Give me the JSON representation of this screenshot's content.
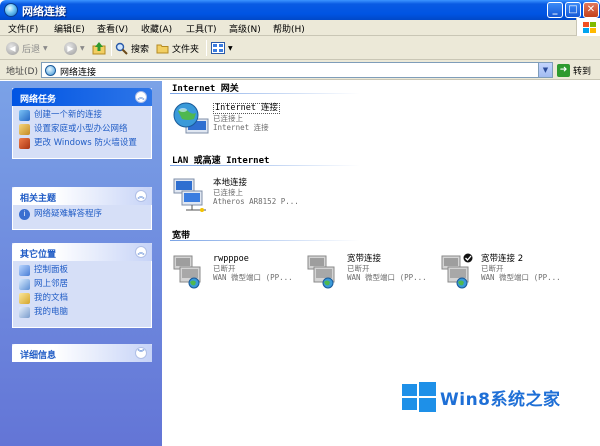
{
  "window": {
    "title": "网络连接"
  },
  "menu": [
    "文件(F)",
    "编辑(E)",
    "查看(V)",
    "收藏(A)",
    "工具(T)",
    "高级(N)",
    "帮助(H)"
  ],
  "toolbar": {
    "back": "后退",
    "search": "搜索",
    "folders": "文件夹"
  },
  "address": {
    "label": "地址(D)",
    "value": "网络连接",
    "go": "转到"
  },
  "taskpane": {
    "network_tasks": {
      "title": "网络任务",
      "items": [
        "创建一个新的连接",
        "设置家庭或小型办公网络",
        "更改 Windows 防火墙设置"
      ]
    },
    "related": {
      "title": "相关主题",
      "items": [
        "网络疑难解答程序"
      ]
    },
    "other_places": {
      "title": "其它位置",
      "items": [
        "控制面板",
        "网上邻居",
        "我的文档",
        "我的电脑"
      ]
    },
    "details": {
      "title": "详细信息"
    }
  },
  "groups": {
    "internet_gateway": {
      "title": "Internet 网关",
      "item": {
        "name": "Internet 连接",
        "status": "已连接上",
        "detail": "Internet 连接"
      }
    },
    "lan": {
      "title": "LAN 或高速 Internet",
      "item": {
        "name": "本地连接",
        "status": "已连接上",
        "detail": "Atheros AR8152 P..."
      }
    },
    "broadband": {
      "title": "宽带",
      "items": [
        {
          "name": "rwpppoe",
          "status": "已断开",
          "detail": "WAN 微型端口 (PP..."
        },
        {
          "name": "宽带连接",
          "status": "已断开",
          "detail": "WAN 微型端口 (PP..."
        },
        {
          "name": "宽带连接 2",
          "status": "已断开",
          "detail": "WAN 微型端口 (PP..."
        }
      ]
    }
  },
  "watermark": "Win8系统之家"
}
